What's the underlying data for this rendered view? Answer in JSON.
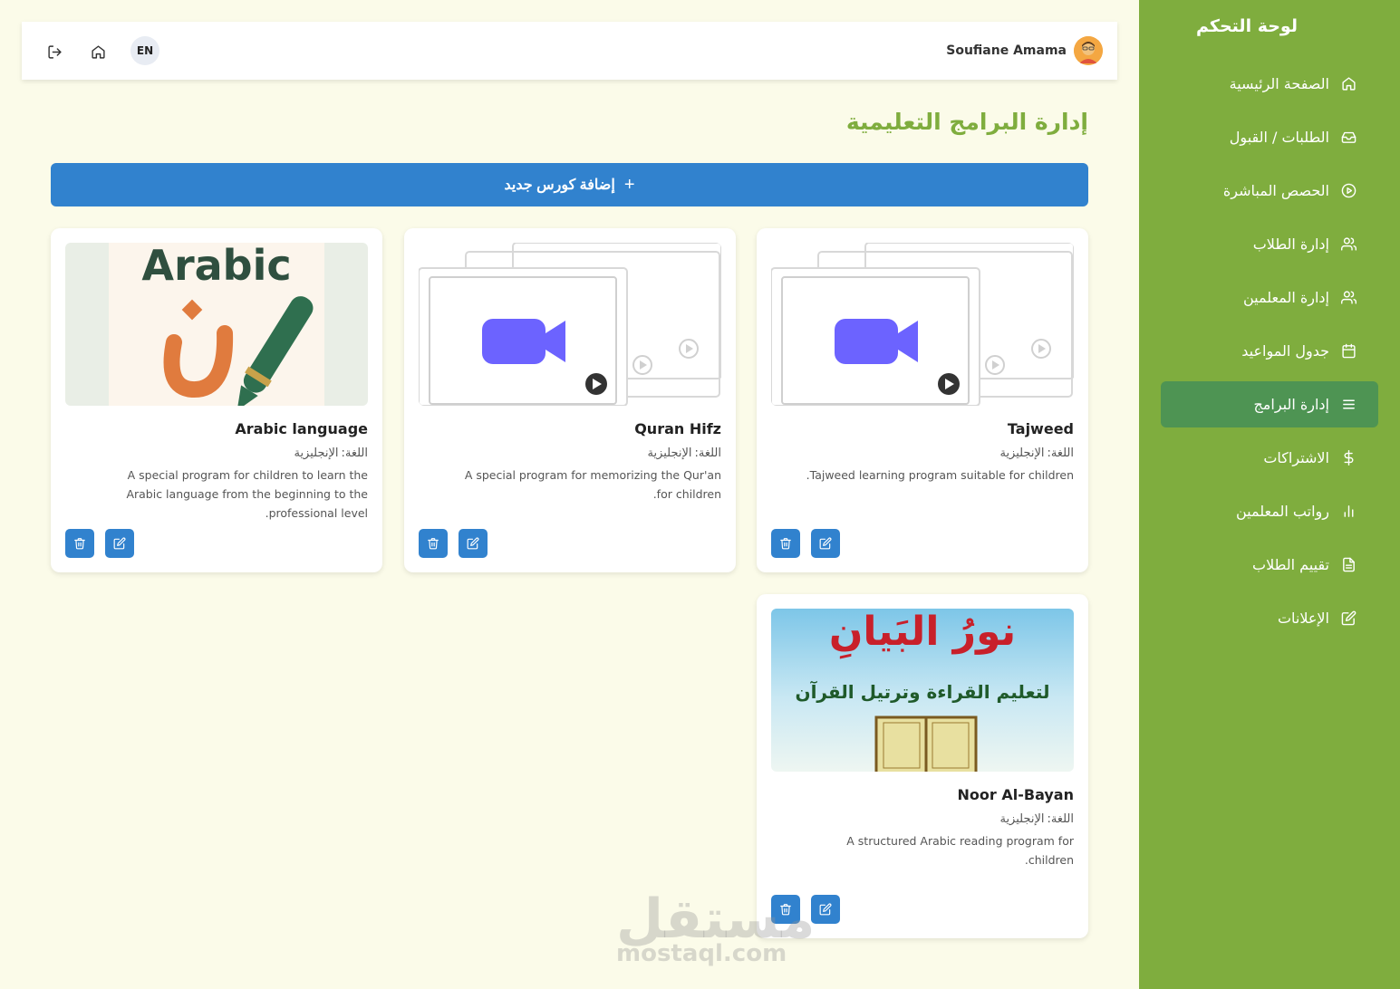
{
  "sidebar": {
    "title": "لوحة التحكم",
    "items": [
      {
        "label": "الصفحة الرئيسية",
        "icon": "home-icon"
      },
      {
        "label": "الطلبات / القبول",
        "icon": "inbox-icon"
      },
      {
        "label": "الحصص المباشرة",
        "icon": "play-circle-icon"
      },
      {
        "label": "إدارة الطلاب",
        "icon": "users-icon"
      },
      {
        "label": "إدارة المعلمين",
        "icon": "users-icon"
      },
      {
        "label": "جدول المواعيد",
        "icon": "calendar-icon"
      },
      {
        "label": "إدارة البرامج",
        "icon": "list-icon",
        "active": true
      },
      {
        "label": "الاشتراكات",
        "icon": "dollar-icon"
      },
      {
        "label": "رواتب المعلمين",
        "icon": "bar-chart-icon"
      },
      {
        "label": "تقييم الطلاب",
        "icon": "file-text-icon"
      },
      {
        "label": "الإعلانات",
        "icon": "edit-icon"
      }
    ]
  },
  "topbar": {
    "username": "Soufiane Amama",
    "language": "EN"
  },
  "page": {
    "title": "إدارة البرامج التعليمية",
    "add_button": "إضافة كورس جديد"
  },
  "courses": [
    {
      "title": "Tajweed",
      "lang_label": "اللغة:",
      "lang_value": "الإنجليزية",
      "description": "Tajweed learning program suitable for children.",
      "thumb": "video-placeholder"
    },
    {
      "title": "Quran Hifz",
      "lang_label": "اللغة:",
      "lang_value": "الإنجليزية",
      "description": "A special program for memorizing the Qur'an for children.",
      "thumb": "video-placeholder"
    },
    {
      "title": "Arabic language",
      "lang_label": "اللغة:",
      "lang_value": "الإنجليزية",
      "description": "A special program for children to learn the Arabic language from the beginning to the professional level.",
      "thumb": "arabic-image",
      "thumb_text": "Arabic"
    },
    {
      "title": "Noor Al-Bayan",
      "lang_label": "اللغة:",
      "lang_value": "الإنجليزية",
      "description": "A structured Arabic reading program for children.",
      "thumb": "noor-image",
      "thumb_text": "نورُ البَيانِ",
      "thumb_subtext": "لتعليم القراءة وترتيل القرآن"
    }
  ],
  "watermark": {
    "text": "مستقل",
    "domain": "mostaql.com"
  },
  "colors": {
    "sidebar": "#7fad3e",
    "active": "#4e9453",
    "primary": "#3182ce",
    "background": "#fbfbe9"
  }
}
